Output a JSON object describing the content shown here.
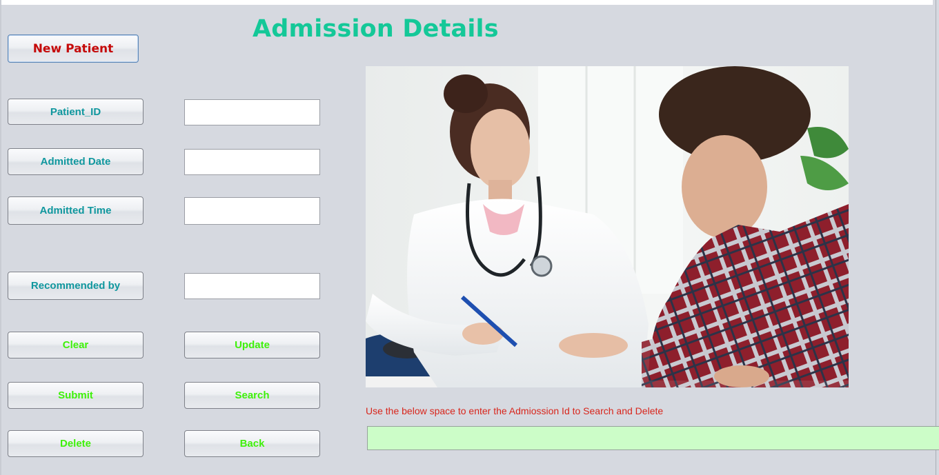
{
  "form": {
    "title": "Admission Details",
    "new_patient_label": "New Patient"
  },
  "fields": [
    {
      "label": "Patient_ID",
      "value": ""
    },
    {
      "label": "Admitted Date",
      "value": ""
    },
    {
      "label": "Admitted Time",
      "value": ""
    },
    {
      "label": "Recommended by",
      "value": ""
    }
  ],
  "actions": {
    "clear": "Clear",
    "update": "Update",
    "submit": "Submit",
    "search": "Search",
    "delete": "Delete",
    "back": "Back"
  },
  "search_box": {
    "hint": "Use the below space to enter the Admiossion Id to Search and Delete",
    "value": ""
  },
  "colors": {
    "title": "#14c898",
    "label_text": "#10979e",
    "action_text": "#3ef10a",
    "new_patient_text": "#c50a0a",
    "hint_text": "#d8251b",
    "search_field_bg": "#ccfdc8",
    "window_bg": "#d6d9e0"
  },
  "image": {
    "subject": "doctor-consulting-patient-photo"
  }
}
